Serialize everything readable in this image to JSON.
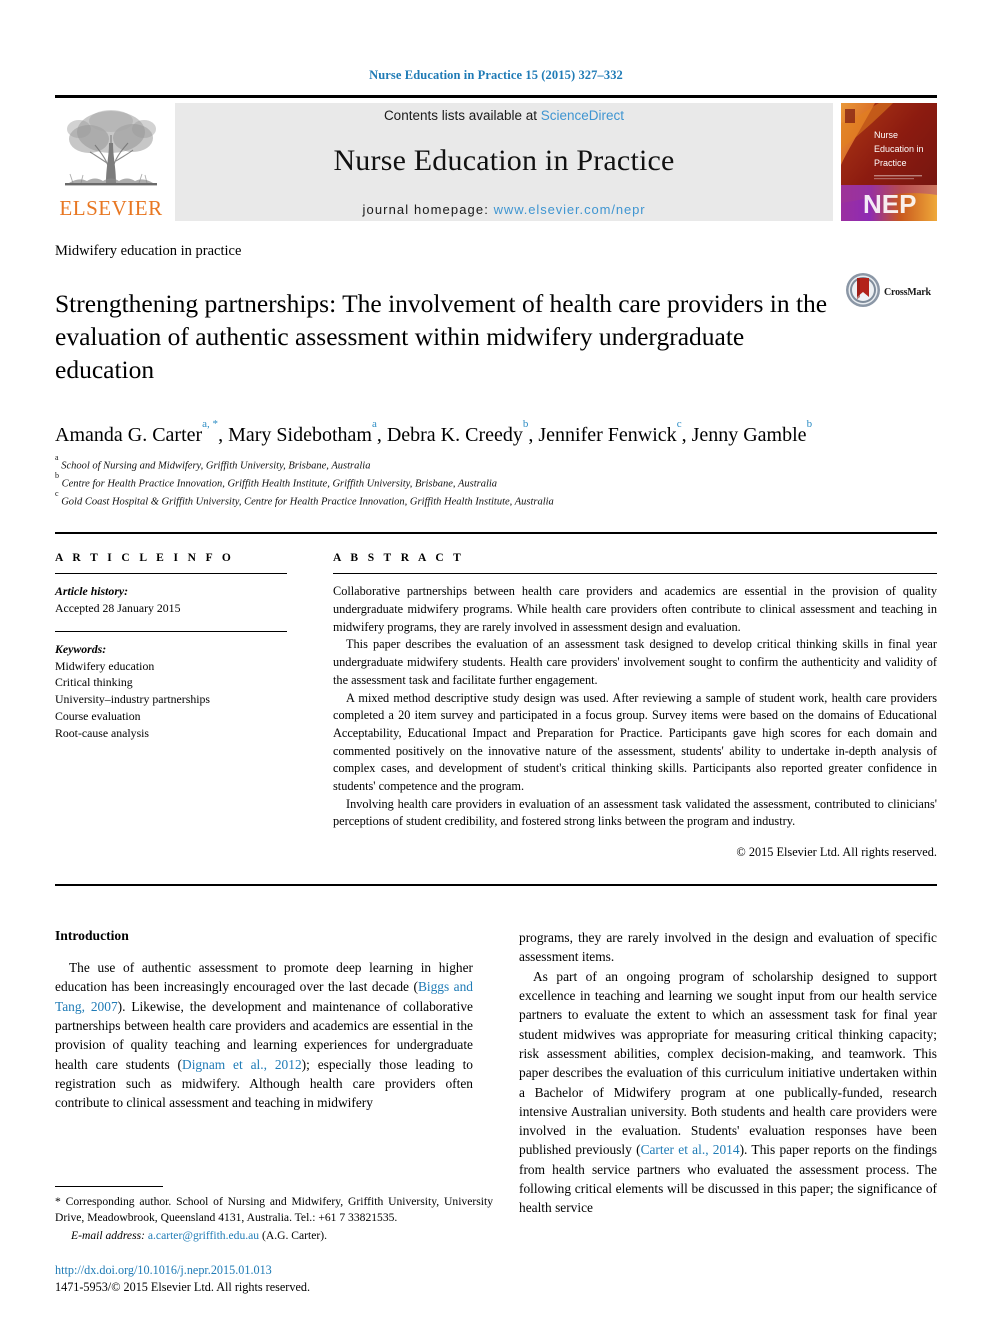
{
  "running_head": "Nurse Education in Practice 15 (2015) 327–332",
  "masthead": {
    "publisher_logo_text": "ELSEVIER",
    "contents_line_prefix": "Contents lists available at ",
    "contents_line_link": "ScienceDirect",
    "journal_title": "Nurse Education in Practice",
    "homepage_prefix": "journal homepage: ",
    "homepage_url": "www.elsevier.com/nepr",
    "cover": {
      "line1": "Nurse",
      "line2": "Education in",
      "line3": "Practice",
      "imprint": "NEP"
    }
  },
  "article": {
    "section_label": "Midwifery education in practice",
    "title": "Strengthening partnerships: The involvement of health care providers in the evaluation of authentic assessment within midwifery undergraduate education",
    "crossmark_label": "CrossMark",
    "authors_line1": "Amanda G. Carter",
    "authors_line1_sup": "a, *",
    "authors": [
      {
        "name": "Amanda G. Carter",
        "sup": "a, *"
      },
      {
        "name": "Mary Sidebotham",
        "sup": "a"
      },
      {
        "name": "Debra K. Creedy",
        "sup": "b"
      },
      {
        "name": "Jennifer Fenwick",
        "sup": "c"
      },
      {
        "name": "Jenny Gamble",
        "sup": "b"
      }
    ],
    "affiliations": [
      {
        "sup": "a",
        "text": "School of Nursing and Midwifery, Griffith University, Brisbane, Australia"
      },
      {
        "sup": "b",
        "text": "Centre for Health Practice Innovation, Griffith Health Institute, Griffith University, Brisbane, Australia"
      },
      {
        "sup": "c",
        "text": "Gold Coast Hospital & Griffith University, Centre for Health Practice Innovation, Griffith Health Institute, Australia"
      }
    ]
  },
  "article_info": {
    "heading": "A R T I C L E   I N F O",
    "history_label": "Article history:",
    "history_value": "Accepted 28 January 2015",
    "keywords_label": "Keywords:",
    "keywords": [
      "Midwifery education",
      "Critical thinking",
      "University–industry partnerships",
      "Course evaluation",
      "Root-cause analysis"
    ]
  },
  "abstract": {
    "heading": "A B S T R A C T",
    "paragraphs": [
      "Collaborative partnerships between health care providers and academics are essential in the provision of quality undergraduate midwifery programs. While health care providers often contribute to clinical assessment and teaching in midwifery programs, they are rarely involved in assessment design and evaluation.",
      "This paper describes the evaluation of an assessment task designed to develop critical thinking skills in final year undergraduate midwifery students. Health care providers' involvement sought to confirm the authenticity and validity of the assessment task and facilitate further engagement.",
      "A mixed method descriptive study design was used. After reviewing a sample of student work, health care providers completed a 20 item survey and participated in a focus group. Survey items were based on the domains of Educational Acceptability, Educational Impact and Preparation for Practice. Participants gave high scores for each domain and commented positively on the innovative nature of the assessment, students' ability to undertake in-depth analysis of complex cases, and development of student's critical thinking skills. Participants also reported greater confidence in students' competence and the program.",
      "Involving health care providers in evaluation of an assessment task validated the assessment, contributed to clinicians' perceptions of student credibility, and fostered strong links between the program and industry."
    ],
    "copyright": "© 2015 Elsevier Ltd. All rights reserved."
  },
  "body": {
    "intro_heading": "Introduction",
    "left_p1_a": "The use of authentic assessment to promote deep learning in higher education has been increasingly encouraged over the last decade (",
    "left_p1_cite1": "Biggs and Tang, 2007",
    "left_p1_b": "). Likewise, the development and maintenance of collaborative partnerships between health care providers and academics are essential in the provision of quality teaching and learning experiences for undergraduate health care students (",
    "left_p1_cite2": "Dignam et al., 2012",
    "left_p1_c": "); especially those leading to registration such as midwifery. Although health care providers often contribute to clinical assessment and teaching in midwifery",
    "right_p1": "programs, they are rarely involved in the design and evaluation of specific assessment items.",
    "right_p2_a": "As part of an ongoing program of scholarship designed to support excellence in teaching and learning we sought input from our health service partners to evaluate the extent to which an assessment task for final year student midwives was appropriate for measuring critical thinking capacity; risk assessment abilities, complex decision-making, and teamwork. This paper describes the evaluation of this curriculum initiative undertaken within a Bachelor of Midwifery program at one publically-funded, research intensive Australian university. Both students and health care providers were involved in the evaluation. Students' evaluation responses have been published previously (",
    "right_p2_cite": "Carter et al., 2014",
    "right_p2_b": "). This paper reports on the findings from health service partners who evaluated the assessment process. The following critical elements will be discussed in this paper; the significance of health service"
  },
  "footnotes": {
    "corresponding": "* Corresponding author. School of Nursing and Midwifery, Griffith University, University Drive, Meadowbrook, Queensland 4131, Australia. Tel.: +61 7 33821535.",
    "email_label": "E-mail address:",
    "email_value": "a.carter@griffith.edu.au",
    "email_suffix": "(A.G. Carter).",
    "doi": "http://dx.doi.org/10.1016/j.nepr.2015.01.013",
    "issn": "1471-5953/© 2015 Elsevier Ltd. All rights reserved."
  },
  "colors": {
    "link_blue": "#1f7bb6",
    "sd_blue": "#3f95d1",
    "elsevier_orange": "#E87722",
    "cover_red": "#9a1d13"
  }
}
